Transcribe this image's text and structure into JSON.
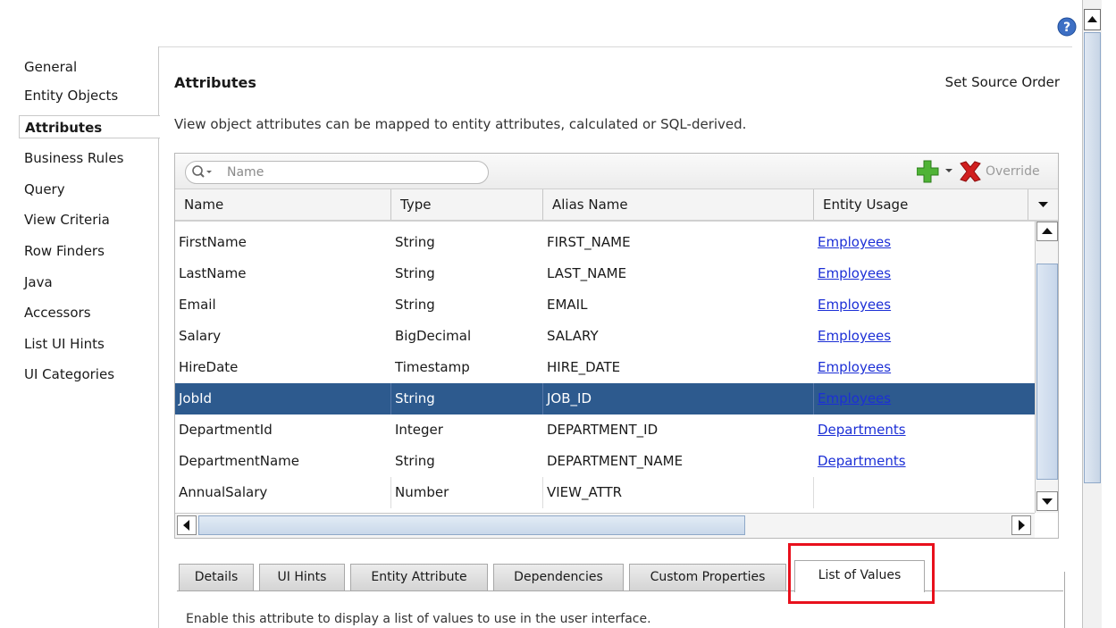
{
  "nav": {
    "items": [
      {
        "label": "General"
      },
      {
        "label": "Entity Objects"
      },
      {
        "label": "Attributes",
        "selected": true
      },
      {
        "label": "Business Rules"
      },
      {
        "label": "Query"
      },
      {
        "label": "View Criteria"
      },
      {
        "label": "Row Finders"
      },
      {
        "label": "Java"
      },
      {
        "label": "Accessors"
      },
      {
        "label": "List UI Hints"
      },
      {
        "label": "UI Categories"
      }
    ]
  },
  "header": {
    "title": "Attributes",
    "set_source_order": "Set Source Order",
    "description": "View object attributes can be mapped to entity attributes, calculated or SQL-derived."
  },
  "toolbar": {
    "search_placeholder": "Name",
    "override_label": "Override",
    "icons": {
      "add": "add-icon",
      "dropdown": "chevron-down-icon",
      "delete": "delete-icon",
      "search": "search-icon"
    }
  },
  "table": {
    "columns": [
      "Name",
      "Type",
      "Alias Name",
      "Entity Usage"
    ],
    "rows": [
      {
        "name": "FirstName",
        "type": "String",
        "alias": "FIRST_NAME",
        "usage": "Employees"
      },
      {
        "name": "LastName",
        "type": "String",
        "alias": "LAST_NAME",
        "usage": "Employees"
      },
      {
        "name": "Email",
        "type": "String",
        "alias": "EMAIL",
        "usage": "Employees"
      },
      {
        "name": "Salary",
        "type": "BigDecimal",
        "alias": "SALARY",
        "usage": "Employees"
      },
      {
        "name": "HireDate",
        "type": "Timestamp",
        "alias": "HIRE_DATE",
        "usage": "Employees"
      },
      {
        "name": "JobId",
        "type": "String",
        "alias": "JOB_ID",
        "usage": "Employees",
        "selected": true
      },
      {
        "name": "DepartmentId",
        "type": "Integer",
        "alias": "DEPARTMENT_ID",
        "usage": "Departments"
      },
      {
        "name": "DepartmentName",
        "type": "String",
        "alias": "DEPARTMENT_NAME",
        "usage": "Departments"
      },
      {
        "name": "AnnualSalary",
        "type": "Number",
        "alias": "VIEW_ATTR",
        "usage": ""
      }
    ]
  },
  "tabs": [
    {
      "label": "Details"
    },
    {
      "label": "UI Hints"
    },
    {
      "label": "Entity Attribute"
    },
    {
      "label": "Dependencies"
    },
    {
      "label": "Custom Properties"
    },
    {
      "label": "List of Values",
      "active": true
    }
  ],
  "lov": {
    "description": "Enable this attribute to display a list of values to use in the user interface."
  },
  "colors": {
    "selection": "#2d5a8e",
    "link": "#1c2fd6",
    "highlight": "#e8101c"
  }
}
